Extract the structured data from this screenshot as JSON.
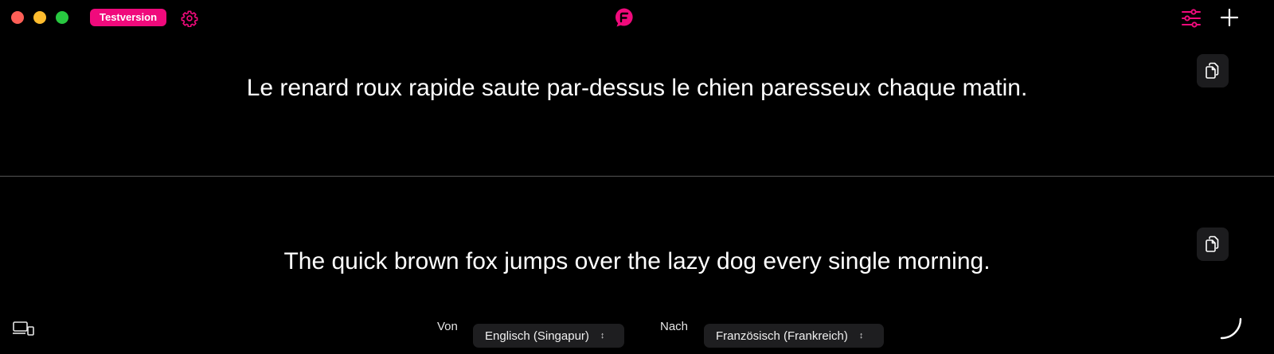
{
  "titlebar": {
    "badge_label": "Testversion"
  },
  "colors": {
    "accent": "#f00a7c",
    "background": "#000000",
    "divider": "#555555"
  },
  "icons": {
    "settings": "gear-icon",
    "logo": "app-logo-icon",
    "filters": "sliders-icon",
    "add": "plus-icon",
    "copy": "copy-icon",
    "devices": "devices-icon",
    "activity": "spinner-icon"
  },
  "translation": {
    "output_text": "Le renard roux rapide saute par-dessus le chien paresseux chaque matin.",
    "input_text": "The quick brown fox jumps over the lazy dog every single morning."
  },
  "language_bar": {
    "from_label": "Von",
    "from_value": "Englisch (Singapur)",
    "to_label": "Nach",
    "to_value": "Französisch (Frankreich)"
  }
}
